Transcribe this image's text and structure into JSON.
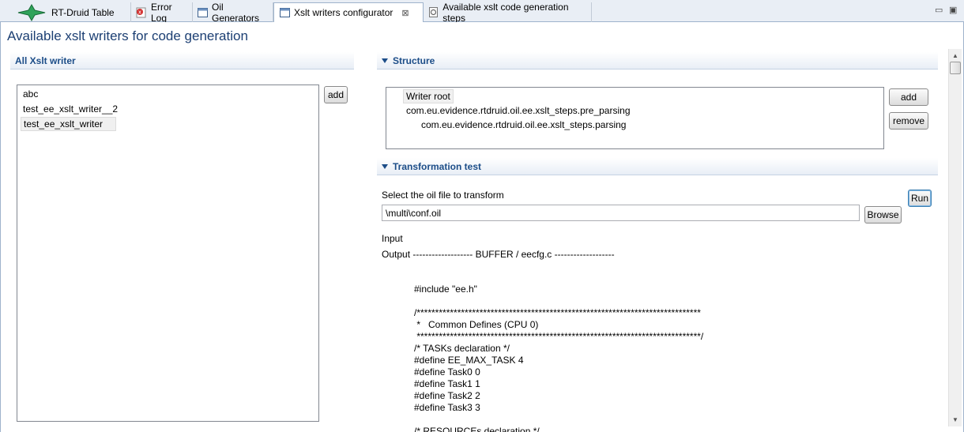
{
  "tabs": [
    {
      "label": "RT-Druid Table",
      "icon": "rt-druid-star-icon"
    },
    {
      "label": "Error Log",
      "icon": "error-log-icon"
    },
    {
      "label": "Oil Generators",
      "icon": "editor-window-icon"
    },
    {
      "label": "Xslt writers configurator",
      "icon": "editor-window-icon",
      "active": true
    },
    {
      "label": "Available xslt code generation steps",
      "icon": "xslt-step-icon"
    }
  ],
  "page_title": "Available xslt writers for code generation",
  "all_writers": {
    "header": "All Xslt writer",
    "items": [
      "abc",
      "test_ee_xslt_writer__2",
      "test_ee_xslt_writer"
    ],
    "selected_index": 2,
    "add_label": "add"
  },
  "structure": {
    "header": "Structure",
    "items": [
      "Writer root",
      "com.eu.evidence.rtdruid.oil.ee.xslt_steps.pre_parsing",
      "com.eu.evidence.rtdruid.oil.ee.xslt_steps.parsing"
    ],
    "add_label": "add",
    "remove_label": "remove"
  },
  "transformation": {
    "header": "Transformation test",
    "select_label": "Select the oil file to transform",
    "file_value": "\\multi\\conf.oil",
    "browse_label": "Browse",
    "run_label": "Run",
    "input_label": "Input",
    "output_label": "Output ------------------- BUFFER  / eecfg.c -------------------",
    "code_lines": [
      "#include \"ee.h\"",
      "",
      "/*****************************************************************************",
      " *   Common Defines (CPU 0)",
      " *****************************************************************************/",
      "/* TASKs declaration */",
      "#define EE_MAX_TASK 4",
      "#define Task0 0",
      "#define Task1 1",
      "#define Task2 2",
      "#define Task3 3",
      "",
      "/* RESOURCEs declaration */"
    ]
  },
  "colors": {
    "title": "#1c3f73",
    "section_header_text": "#1c4d88",
    "tab_bar": "#e9eef5"
  }
}
